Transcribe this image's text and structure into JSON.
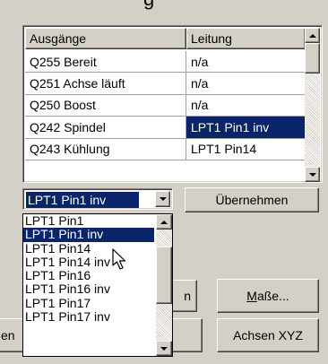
{
  "columns": {
    "a": "Ausgänge",
    "b": "Leitung"
  },
  "rows": [
    {
      "output": "Q255 Bereit",
      "line": "n/a",
      "selected": false
    },
    {
      "output": "Q251 Achse läuft",
      "line": "n/a",
      "selected": false
    },
    {
      "output": "Q250 Boost",
      "line": "n/a",
      "selected": false
    },
    {
      "output": "Q242 Spindel",
      "line": "LPT1 Pin1 inv",
      "selected": true
    },
    {
      "output": "Q243 Kühlung",
      "line": "LPT1 Pin14",
      "selected": false
    }
  ],
  "combo": {
    "value": "LPT1 Pin1 inv"
  },
  "buttons": {
    "apply": "Übernehmen",
    "partial_left": "n",
    "dimensions_u": "M",
    "dimensions_rest": "aße...",
    "partial_left2": "en",
    "axes": "Achsen XYZ"
  },
  "dropdown": {
    "options": [
      "LPT1 Pin1",
      "LPT1 Pin1 inv",
      "LPT1 Pin14",
      "LPT1 Pin14 inv",
      "LPT1 Pin16",
      "LPT1 Pin16 inv",
      "LPT1 Pin17",
      "LPT1 Pin17 inv"
    ],
    "selected_index": 1
  },
  "colors": {
    "window": "#d4d0c8",
    "selection": "#0a246a"
  }
}
